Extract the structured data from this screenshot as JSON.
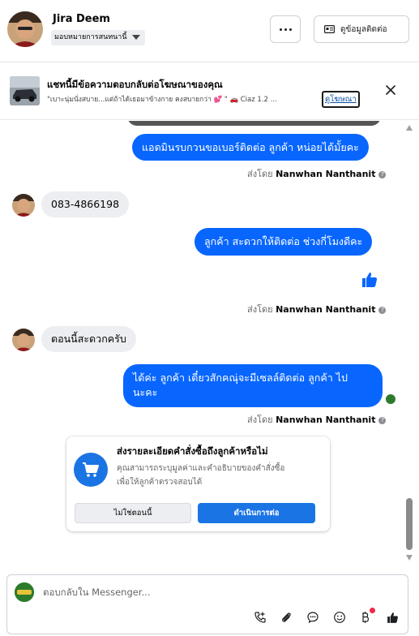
{
  "header": {
    "contact_name": "Jira Deem",
    "assign_label": "มอบหมายการสนทนานี้",
    "contact_info_button": "ดูข้อมูลติดต่อ"
  },
  "banner": {
    "title": "แชทนี้มีข้อความตอบกลับต่อโฆษณาของคุณ",
    "snippet": "\"เบาะนุ่มนั่งสบาย...แต่ถ้าได้เธอมาข้างกาย คงสบายกว่า 💕 \" 🚗 Ciaz 1.2 ...",
    "view_ad_link": "ดูโฆษณา"
  },
  "messages": [
    {
      "id": "m1",
      "direction": "out",
      "text": "แอดมินรบกวนขอเบอร์ติดต่อ ลูกค้า หน่อยได้มั้ยคะ"
    },
    {
      "id": "m2",
      "direction": "in",
      "text": "083-4866198"
    },
    {
      "id": "m3",
      "direction": "out",
      "text": "ลูกค้า สะดวกให้ติดต่อ ช่วงกี่โมงดีคะ"
    },
    {
      "id": "m4",
      "direction": "in",
      "text": "ตอนนี้สะดวกครับ"
    },
    {
      "id": "m5",
      "direction": "out",
      "text_line1": "ได้ค่ะ  ลูกค้า เดี๋ยวสักคณุ่จะมีเซลล์ติดต่อ ลูกค้า ไป",
      "text_line2": "นะคะ"
    }
  ],
  "sent_by": {
    "prefix": "ส่งโดย",
    "name": "Nanwhan Nanthanit"
  },
  "order_card": {
    "title": "ส่งรายละเอียดคำสั่งซื้อถึงลูกค้าหรือไม่",
    "desc_line1": "คุณสามารถระบุมูลค่าและคำอธิบายของคำสั่งซื้อ",
    "desc_line2": "เพื่อให้ลูกค้าตรวจสอบได้",
    "decline_button": "ไม่ใช่ตอนนี้",
    "proceed_button": "ดำเนินการต่อ"
  },
  "composer": {
    "placeholder": "ตอบกลับใน Messenger...",
    "tools": [
      "call-add-icon",
      "attachment-icon",
      "saved-reply-icon",
      "emoji-icon",
      "payment-icon",
      "like-icon"
    ]
  },
  "colors": {
    "messenger_blue": "#0866ff",
    "incoming_bubble": "#eceef1",
    "button_blue": "#1b74e4",
    "notification_red": "#f02849"
  }
}
